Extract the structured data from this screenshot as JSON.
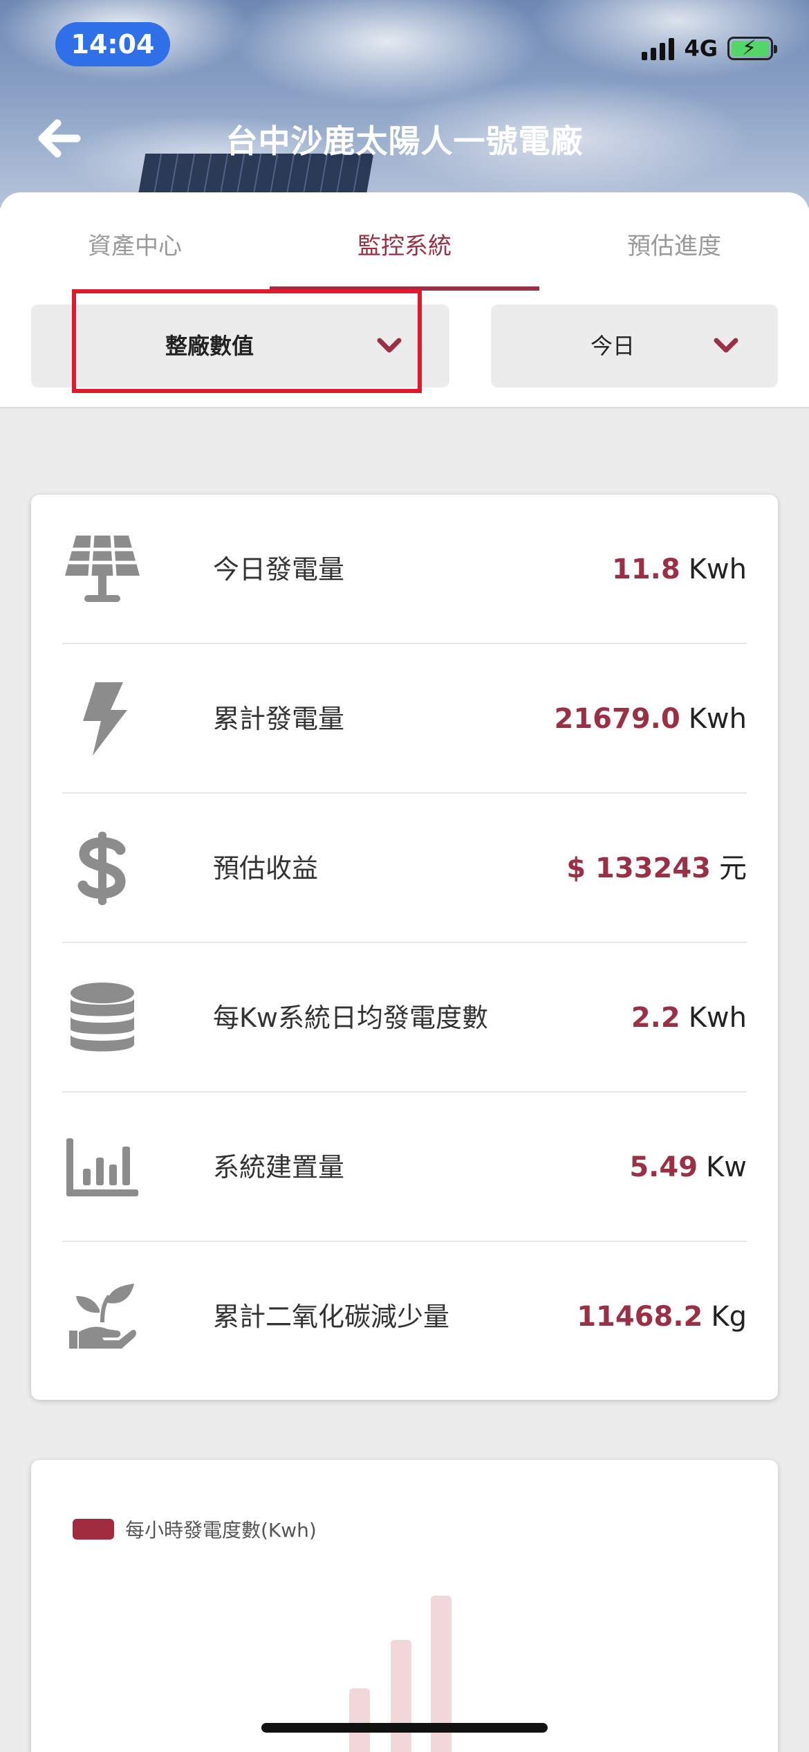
{
  "status_bar": {
    "time": "14:04",
    "network": "4G"
  },
  "header": {
    "title": "台中沙鹿太陽人一號電廠"
  },
  "tabs": [
    {
      "label": "資產中心",
      "active": false
    },
    {
      "label": "監控系統",
      "active": true
    },
    {
      "label": "預估進度",
      "active": false
    }
  ],
  "filters": {
    "scope": "整廠數值",
    "period": "今日"
  },
  "stats": [
    {
      "icon": "solar-panel-icon",
      "label": "今日發電量",
      "value": "11.8",
      "unit": "Kwh"
    },
    {
      "icon": "lightning-icon",
      "label": "累計發電量",
      "value": "21679.0",
      "unit": "Kwh"
    },
    {
      "icon": "dollar-icon",
      "label": "預估收益",
      "value": "$ 133243",
      "unit": "元"
    },
    {
      "icon": "database-icon",
      "label": "每Kw系統日均發電度數",
      "value": "2.2",
      "unit": "Kwh"
    },
    {
      "icon": "bar-chart-icon",
      "label": "系統建置量",
      "value": "5.49",
      "unit": "Kw"
    },
    {
      "icon": "plant-hand-icon",
      "label": "累計二氧化碳減少量",
      "value": "11468.2",
      "unit": "Kg"
    }
  ],
  "chart": {
    "legend": "每小時發電度數(Kwh)"
  },
  "colors": {
    "accent": "#9b2f45",
    "highlight": "#e0192d",
    "time_pill": "#2f6fe8",
    "bar": "#f1d6da"
  }
}
